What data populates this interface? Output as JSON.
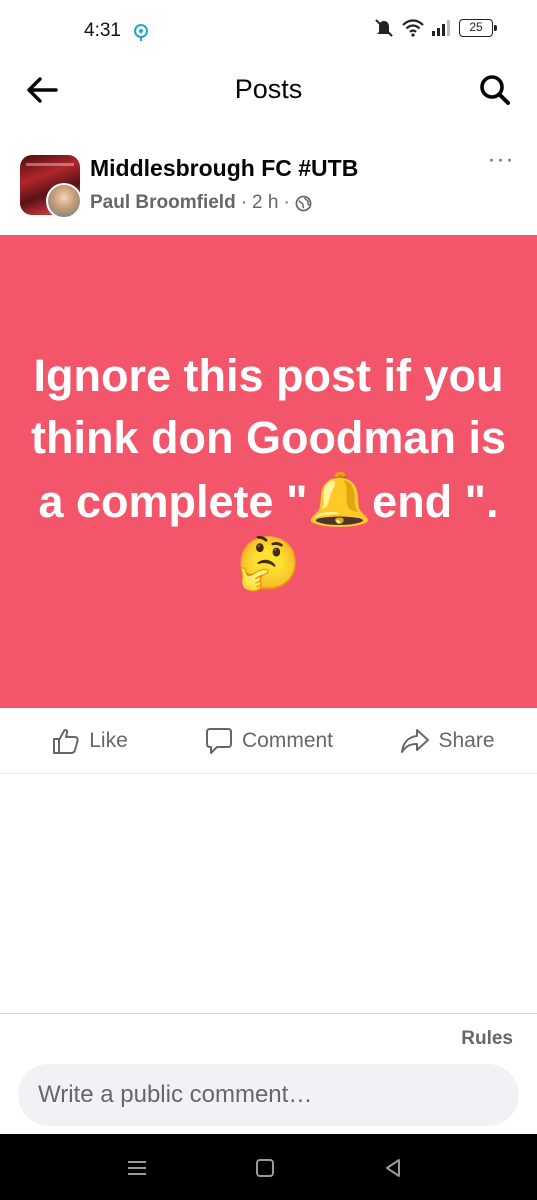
{
  "status_bar": {
    "time": "4:31",
    "battery": "25"
  },
  "header": {
    "title": "Posts"
  },
  "post": {
    "group_name": "Middlesbrough FC #UTB",
    "author": "Paul Broomfield",
    "time_ago": "2 h",
    "separator": "·",
    "text_before": "Ignore this post if you think don Goodman is a complete \"",
    "text_emoji": "🔔",
    "text_after": "end \".",
    "text_trailing_emoji": "🤔",
    "background_color": "#f3566b"
  },
  "actions": {
    "like": "Like",
    "comment": "Comment",
    "share": "Share"
  },
  "comments": {
    "rules": "Rules",
    "placeholder": "Write a public comment…"
  },
  "icons": {
    "back": "back-arrow-icon",
    "search": "search-icon",
    "more": "more-options-icon",
    "globe": "globe-icon",
    "like": "thumbs-up-icon",
    "comment": "speech-bubble-icon",
    "share": "share-arrow-icon"
  }
}
